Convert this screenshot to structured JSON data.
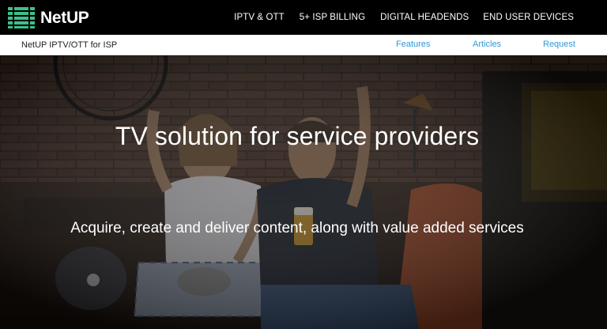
{
  "header": {
    "logo_text": "NetUP",
    "nav": [
      {
        "label": "IPTV & OTT"
      },
      {
        "label": "5+ ISP BILLING"
      },
      {
        "label": "DIGITAL HEADENDS"
      },
      {
        "label": "END USER DEVICES"
      }
    ]
  },
  "subbar": {
    "title": "NetUP IPTV/OTT for ISP",
    "links": [
      {
        "label": "Features"
      },
      {
        "label": "Articles"
      },
      {
        "label": "Request"
      }
    ]
  },
  "hero": {
    "title": "TV solution for service providers",
    "subtitle": "Acquire, create and deliver content, along with value added services"
  },
  "colors": {
    "logo_green": "#3dbf8a",
    "link_blue": "#2e97d8",
    "nav_bg": "#000000"
  }
}
